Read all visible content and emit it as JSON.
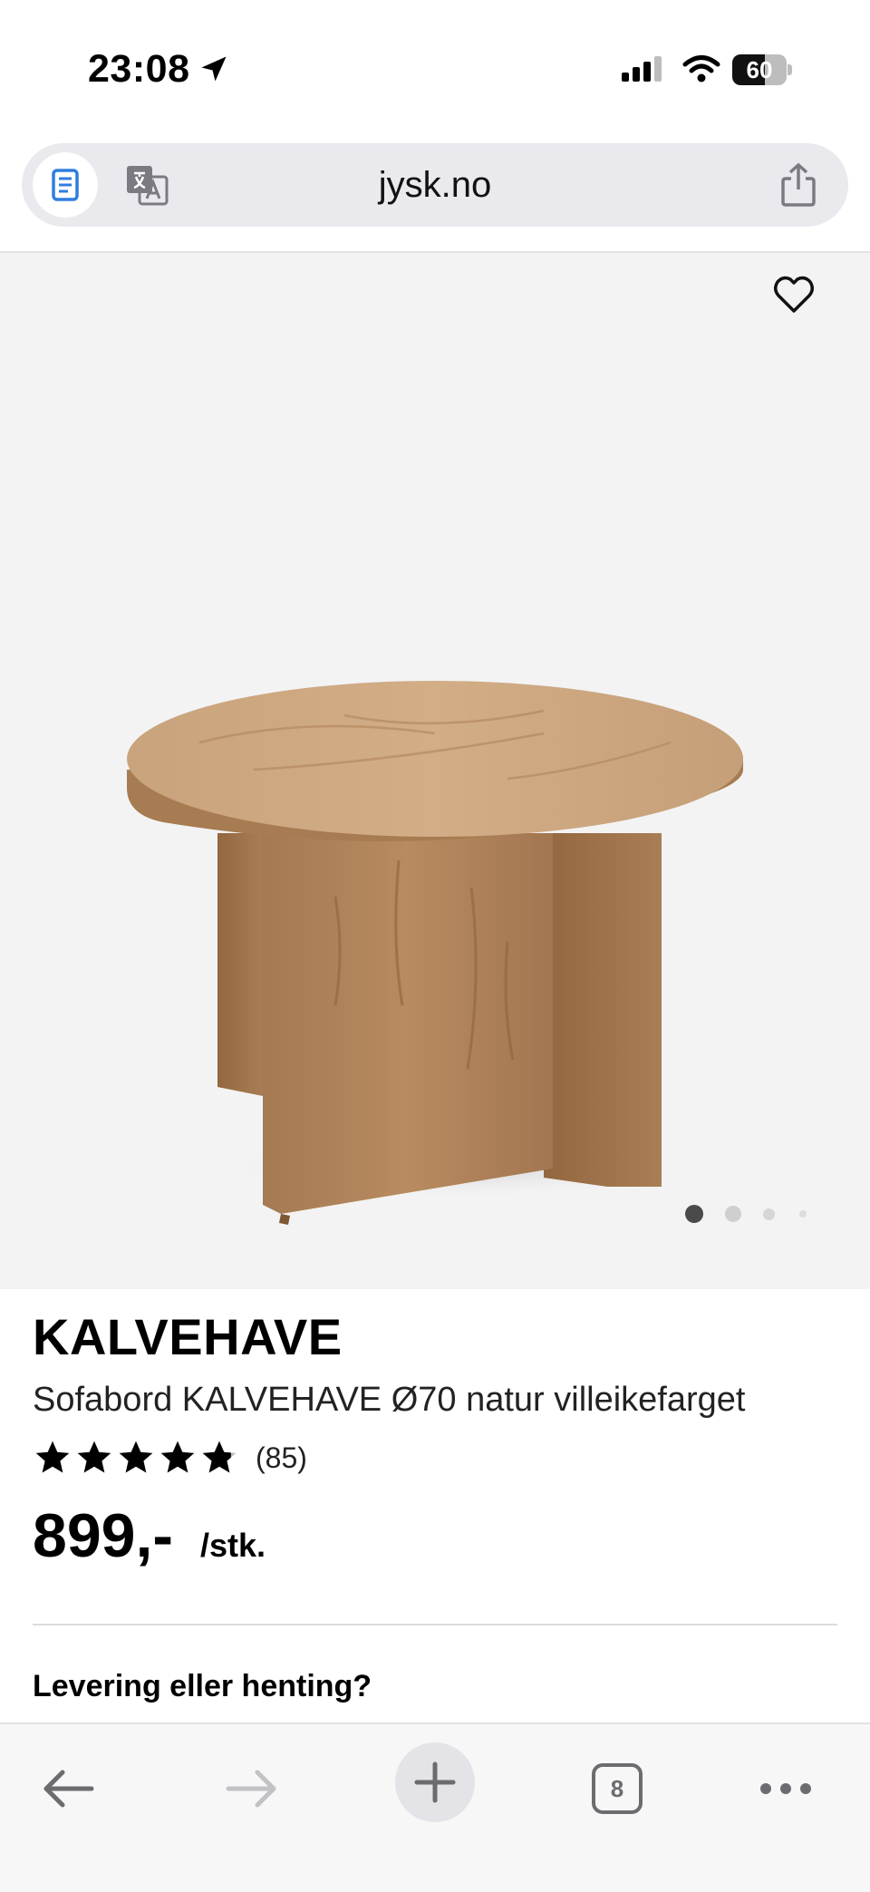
{
  "status_bar": {
    "time": "23:08",
    "battery": "60",
    "battery_level": 0.6
  },
  "browser": {
    "url": "jysk.no",
    "open_tabs": "8"
  },
  "product": {
    "brand_title": "KALVEHAVE",
    "name": "Sofabord KALVEHAVE Ø70 natur villeikefarget",
    "rating_stars": 4.8,
    "rating_count": "(85)",
    "price": "899,-",
    "unit": "/stk.",
    "image_count": 4,
    "active_image": 1
  },
  "sections": {
    "delivery_heading": "Levering eller henting?"
  },
  "icons": {
    "location": "location-arrow-icon",
    "signal": "cellular-signal-icon",
    "wifi": "wifi-icon",
    "reader": "reader-mode-icon",
    "translate": "translate-icon",
    "share": "share-icon",
    "favorite": "heart-icon",
    "back": "back-arrow-icon",
    "forward": "forward-arrow-icon",
    "new_tab": "plus-icon",
    "tabs": "tabs-icon",
    "more": "more-icon"
  },
  "colors": {
    "reader_icon": "#2f7de1",
    "star": "#000000",
    "media_bg": "#f3f3f4"
  }
}
